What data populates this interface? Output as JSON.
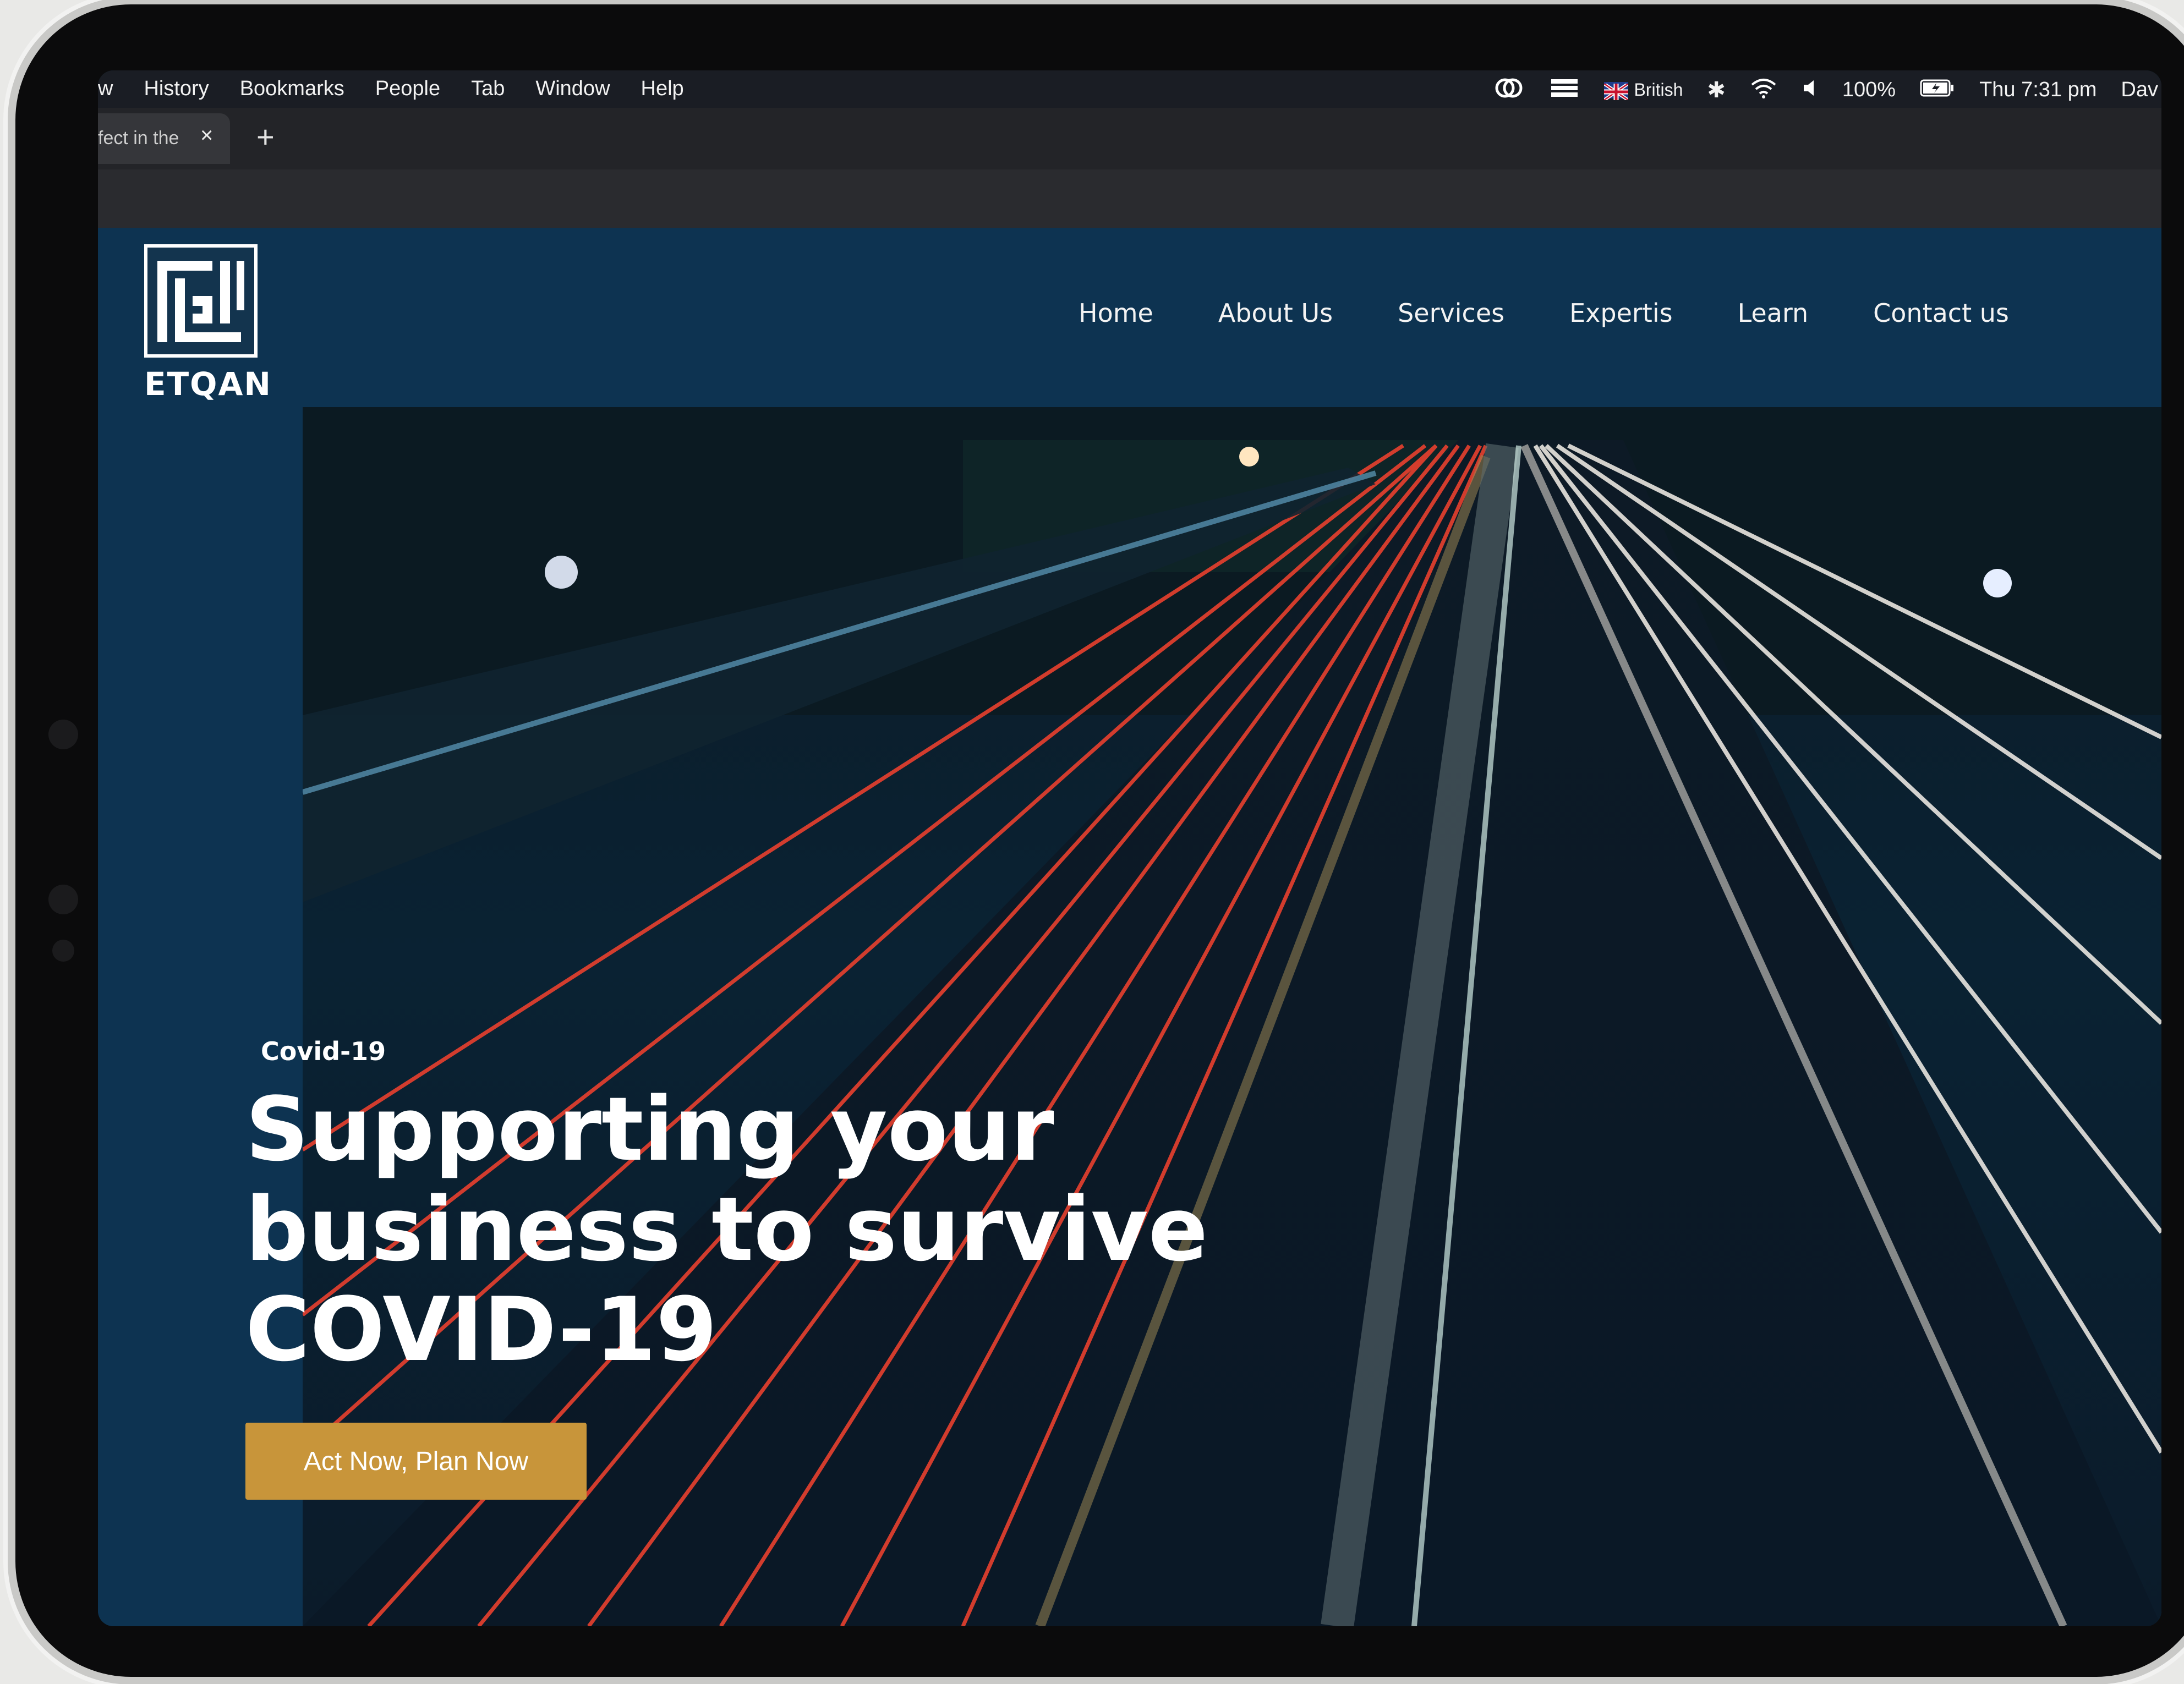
{
  "menubar": {
    "items": [
      "w",
      "History",
      "Bookmarks",
      "People",
      "Tab",
      "Window",
      "Help"
    ],
    "status": {
      "keyboard": "British",
      "battery": "100%",
      "clock": "Thu 7:31 pm",
      "user": "Dav"
    }
  },
  "browser": {
    "tab_title": "fect in the",
    "tab_close": "×",
    "new_tab": "+"
  },
  "site": {
    "logo_text": "ETQAN",
    "nav": [
      "Home",
      "About Us",
      "Services",
      "Expertis",
      "Learn",
      "Contact us"
    ],
    "hero": {
      "eyebrow": "Covid-19",
      "headline_line1": "Supporting your",
      "headline_line2": "business to survive",
      "headline_line3": "COVID-19",
      "cta_label": "Act Now, Plan Now"
    },
    "colors": {
      "navy": "#0d3351",
      "cta_gold": "#c8953a"
    }
  }
}
